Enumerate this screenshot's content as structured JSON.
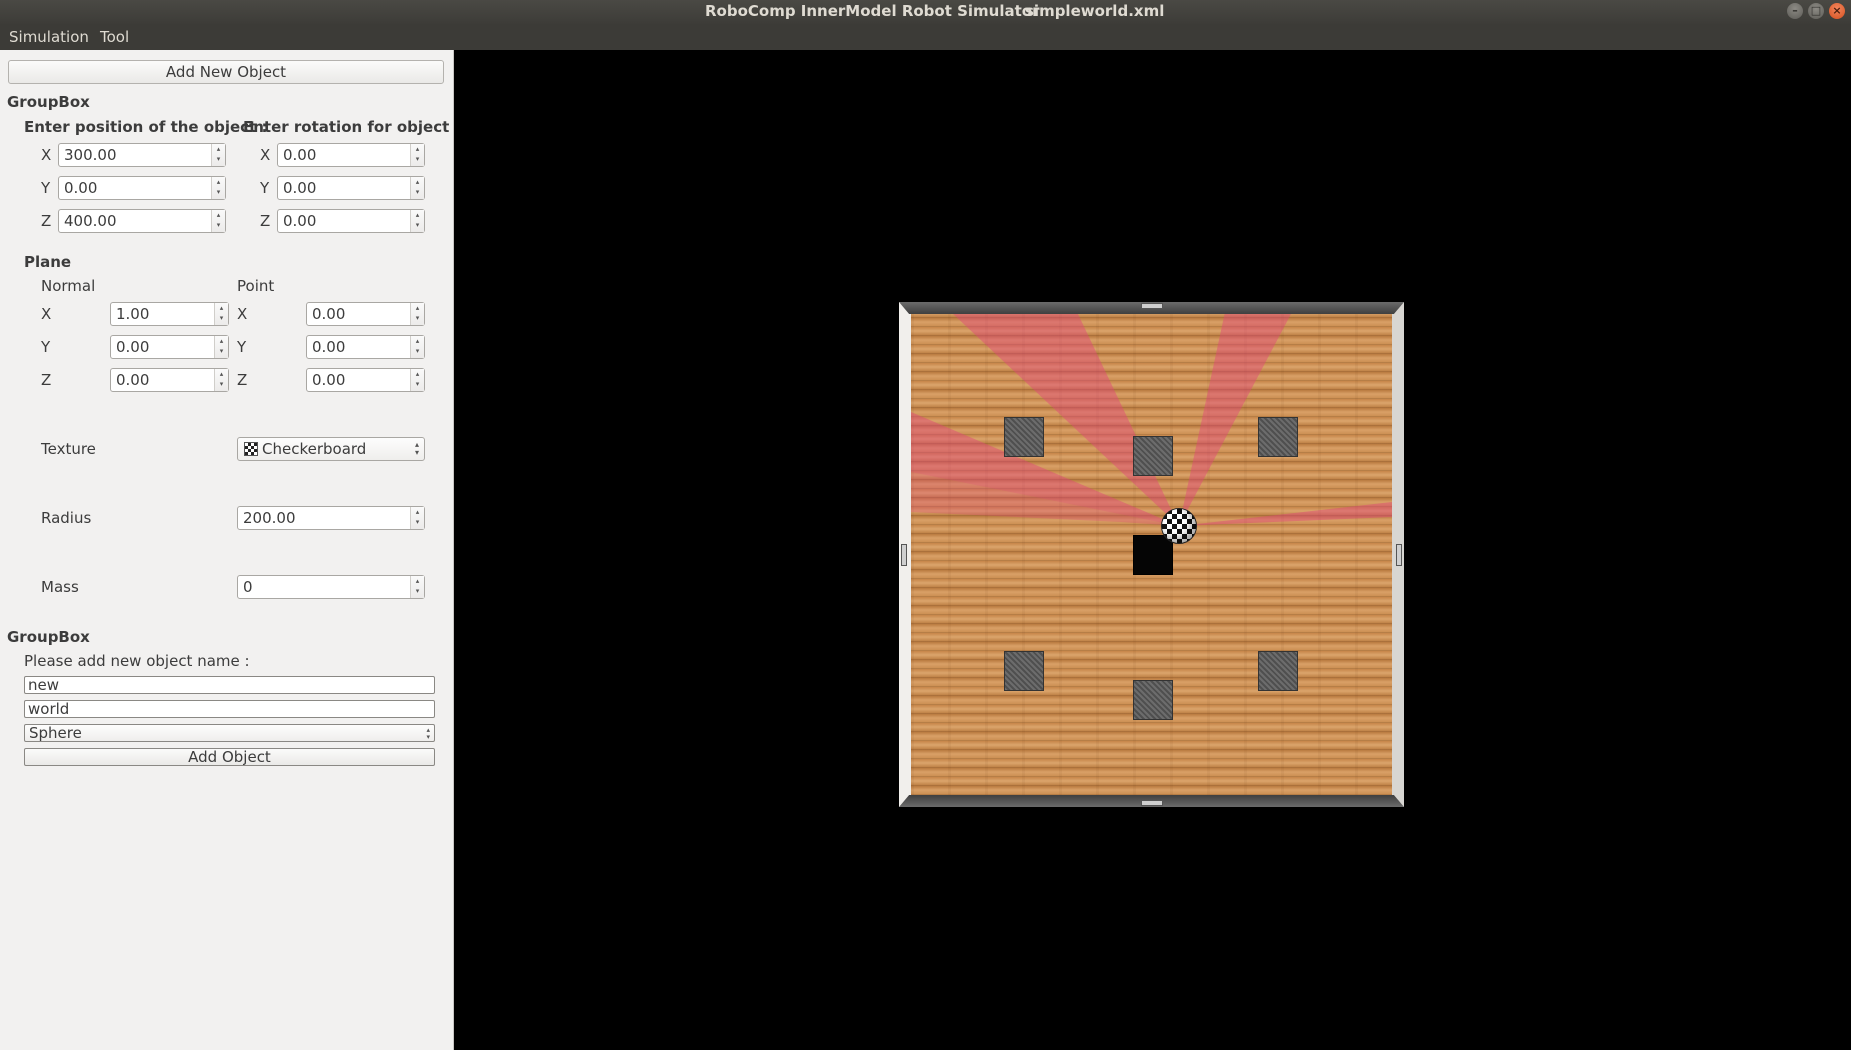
{
  "window": {
    "title": "RoboComp InnerModel Robot Simulator",
    "file": "simpleworld.xml",
    "minimize_glyph": "–",
    "maximize_glyph": "□",
    "close_glyph": "×"
  },
  "menu": {
    "items": [
      "Simulation",
      "Tool"
    ]
  },
  "panel": {
    "add_new_object_label": "Add New Object",
    "groupbox1_title": "GroupBox",
    "position_heading": "Enter position of the object :",
    "rotation_heading": "Enter rotation for object :",
    "position": {
      "x_label": "X",
      "x": "300.00",
      "y_label": "Y",
      "y": "0.00",
      "z_label": "Z",
      "z": "400.00"
    },
    "rotation": {
      "x_label": "X",
      "x": "0.00",
      "y_label": "Y",
      "y": "0.00",
      "z_label": "Z",
      "z": "0.00"
    },
    "plane_heading": "Plane",
    "normal_heading": "Normal",
    "point_heading": "Point",
    "normal": {
      "x_label": "X",
      "x": "1.00",
      "y_label": "Y",
      "y": "0.00",
      "z_label": "Z",
      "z": "0.00"
    },
    "point": {
      "x_label": "X",
      "x": "0.00",
      "y_label": "Y",
      "y": "0.00",
      "z_label": "Z",
      "z": "0.00"
    },
    "texture_label": "Texture",
    "texture_value": "Checkerboard",
    "radius_label": "Radius",
    "radius_value": "200.00",
    "mass_label": "Mass",
    "mass_value": "0",
    "groupbox2_title": "GroupBox",
    "name_prompt": "Please add new object name :",
    "name_value": "new",
    "parent_value": "world",
    "shape_value": "Sphere",
    "add_object_label": "Add Object"
  },
  "colors": {
    "laser": "#e0447a",
    "titlebar": "#3c3b37",
    "panel_bg": "#f2f1f0"
  }
}
